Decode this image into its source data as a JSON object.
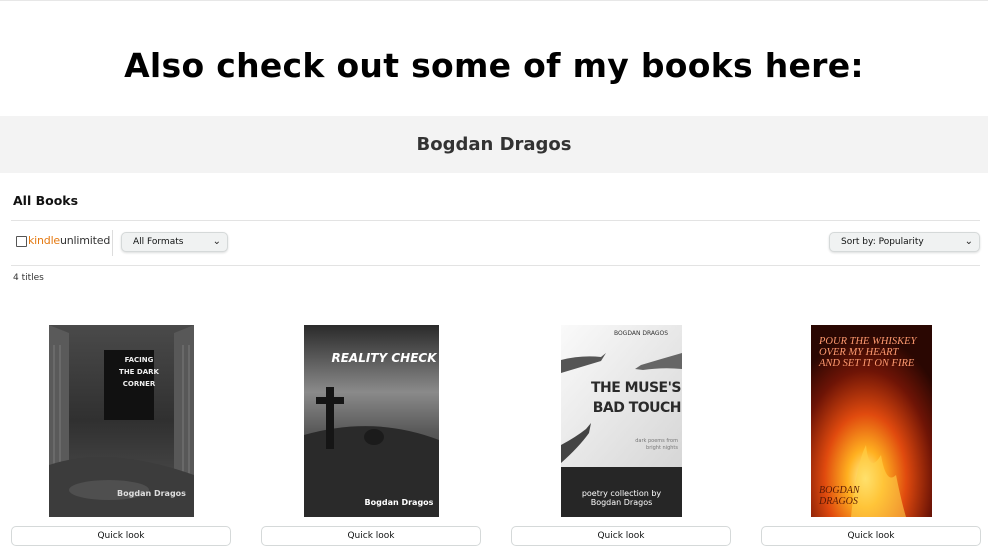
{
  "promo_heading": "Also check out some of my books here:",
  "author": {
    "name": "Bogdan Dragos"
  },
  "section": {
    "title": "All Books"
  },
  "filters": {
    "kindle_unlimited": {
      "kindle": "kindle",
      "unlimited": "unlimited",
      "checked": false
    },
    "format_select": {
      "value": "All Formats"
    },
    "sort_select": {
      "value": "Sort by: Popularity"
    }
  },
  "titles_count": "4 titles",
  "books": [
    {
      "cover_title": [
        "FACING",
        "THE DARK",
        "CORNER"
      ],
      "cover_author": "Bogdan Dragos",
      "quick_look": "Quick look"
    },
    {
      "cover_title": "REALITY CHECK",
      "cover_author": "Bogdan Dragos",
      "quick_look": "Quick look"
    },
    {
      "cover_author_top": "BOGDAN DRAGOS",
      "cover_title": [
        "THE MUSE'S",
        "BAD TOUCH"
      ],
      "cover_subtitle": [
        "dark poems from",
        "bright nights"
      ],
      "cover_footer": [
        "poetry collection by",
        "Bogdan Dragos"
      ],
      "quick_look": "Quick look"
    },
    {
      "cover_title": [
        "POUR THE WHISKEY",
        "OVER MY HEART",
        "AND SET IT ON FIRE"
      ],
      "cover_author": [
        "BOGDAN",
        "DRAGOS"
      ],
      "quick_look": "Quick look"
    }
  ],
  "colors": {
    "kindle_orange": "#e47911",
    "band_gray": "#f3f3f3",
    "fire_text": "#ff9a70"
  }
}
